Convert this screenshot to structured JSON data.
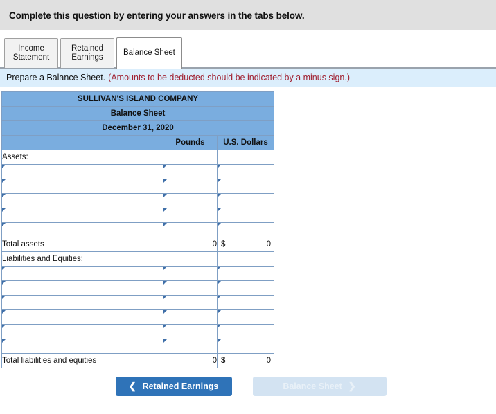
{
  "banner": {
    "text": "Complete this question by entering your answers in the tabs below."
  },
  "tabs": [
    {
      "id": "income-statement",
      "line1": "Income",
      "line2": "Statement",
      "active": false
    },
    {
      "id": "retained-earnings",
      "line1": "Retained",
      "line2": "Earnings",
      "active": false
    },
    {
      "id": "balance-sheet",
      "line1": "Balance Sheet",
      "line2": "",
      "active": true
    }
  ],
  "prepare": {
    "instruction": "Prepare a Balance Sheet.",
    "note": "(Amounts to be deducted should be indicated by a minus sign.)"
  },
  "sheet": {
    "company": "SULLIVAN'S ISLAND COMPANY",
    "statement": "Balance Sheet",
    "date": "December 31, 2020",
    "columns": {
      "blank": "",
      "pounds": "Pounds",
      "usd": "U.S. Dollars"
    },
    "assets": {
      "section_label": "Assets:",
      "entry_rows": 5,
      "total_label": "Total assets",
      "total_pounds": "0",
      "total_usd_symbol": "$",
      "total_usd": "0"
    },
    "liabilities": {
      "section_label": "Liabilities and Equities:",
      "entry_rows": 6,
      "total_label": "Total liabilities and equities",
      "total_pounds": "0",
      "total_usd_symbol": "$",
      "total_usd": "0"
    }
  },
  "nav": {
    "prev_label": "Retained Earnings",
    "prev_icon": "chevron-left-icon",
    "next_label": "Balance Sheet",
    "next_icon": "chevron-right-icon"
  },
  "colors": {
    "header_blue": "#7aaddf",
    "banner_gray": "#e0e0e0",
    "info_blue": "#dbeefc",
    "note_red": "#a02030",
    "button_blue": "#2f73b8",
    "button_disabled": "#d3e3f2"
  }
}
